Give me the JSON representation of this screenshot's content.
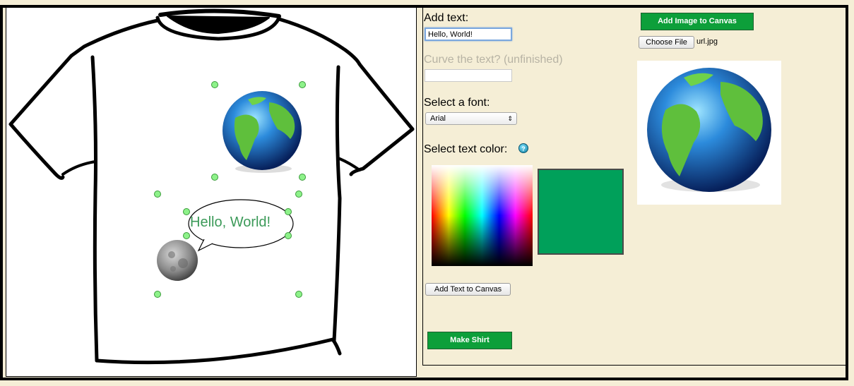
{
  "canvas": {
    "text_object": {
      "text": "Hello, World!",
      "color": "#3c9a59"
    }
  },
  "controls": {
    "add_text_label": "Add text:",
    "text_input_value": "Hello, World!",
    "curve_label": "Curve the text? (unfinished)",
    "curve_input_value": "",
    "font_label": "Select a font:",
    "font_selected": "Arial",
    "color_label": "Select text color:",
    "help_icon": "?",
    "selected_color": "#00a05a",
    "add_text_button": "Add Text to Canvas",
    "make_shirt_button": "Make Shirt",
    "add_image_button": "Add Image to Canvas",
    "choose_file_button": "Choose File",
    "chosen_file": "url.jpg"
  },
  "colors": {
    "background": "#f5eed6",
    "accent_green": "#0d9f3a"
  }
}
